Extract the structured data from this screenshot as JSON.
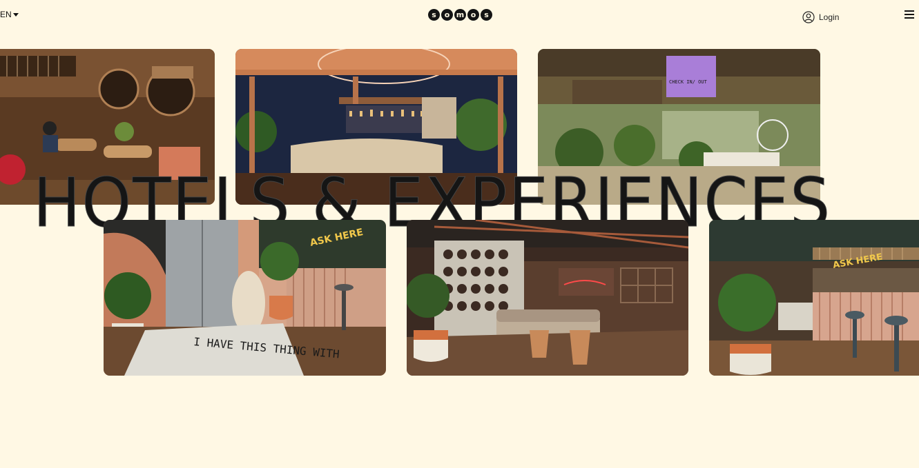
{
  "header": {
    "language": "EN",
    "logo_letters": [
      "s",
      "o",
      "m",
      "o",
      "s"
    ],
    "login_label": "Login"
  },
  "hero": {
    "headline": "HOTELS & EXPERIENCES"
  },
  "photos": {
    "row1": [
      {
        "name": "restaurant-interior-photo"
      },
      {
        "name": "rooftop-bar-photo"
      },
      {
        "name": "lobby-plants-photo",
        "sign_text": "CHECK IN/ OUT"
      }
    ],
    "row2": [
      {
        "name": "elevator-lobby-photo",
        "neon_text": "ASK HERE",
        "floor_text": "I HAVE THIS THING WITH"
      },
      {
        "name": "lounge-photo"
      },
      {
        "name": "bar-counter-photo",
        "neon_text": "ASK HERE"
      }
    ]
  },
  "colors": {
    "background": "#fff8e4",
    "text": "#151515"
  }
}
